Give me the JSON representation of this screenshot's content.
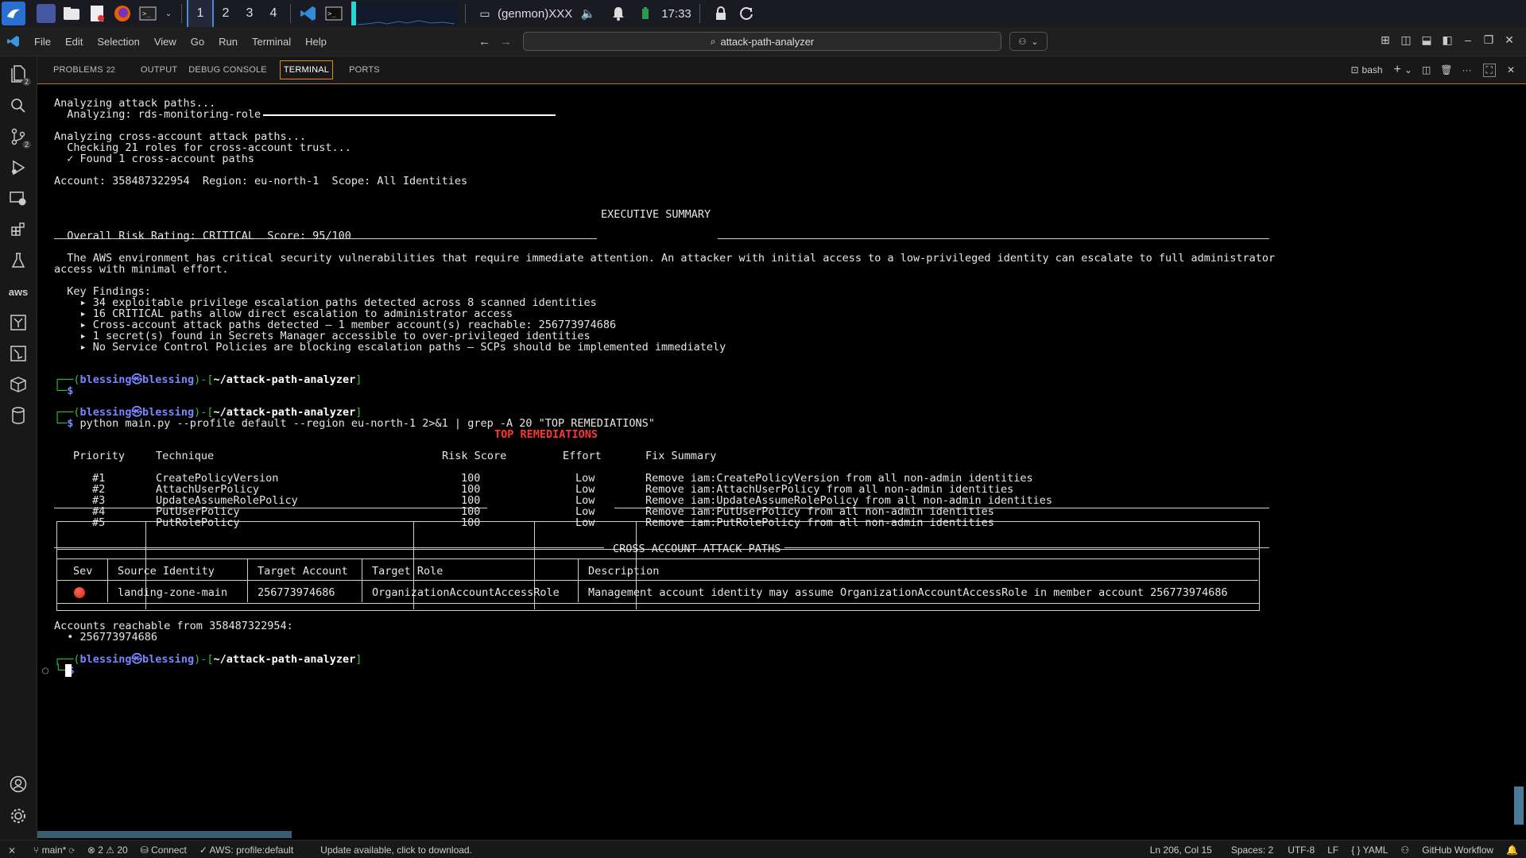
{
  "taskbar": {
    "workspaces": [
      "1",
      "2",
      "3",
      "4"
    ],
    "window_title": "(genmon)XXX",
    "clock": "17:33"
  },
  "titlebar": {
    "menu": [
      "File",
      "Edit",
      "Selection",
      "View",
      "Go",
      "Run",
      "Terminal",
      "Help"
    ],
    "search": "attack-path-analyzer"
  },
  "activity": {
    "explorer_badge": "2",
    "scm_badge": "2",
    "aws_label": "aws"
  },
  "panel": {
    "tabs": {
      "problems": "PROBLEMS",
      "problems_count": "22",
      "output": "OUTPUT",
      "debug": "DEBUG CONSOLE",
      "terminal": "TERMINAL",
      "ports": "PORTS"
    },
    "shell": "bash"
  },
  "terminal": {
    "l1": "Analyzing attack paths...",
    "l2": "  Analyzing: rds-monitoring-role",
    "l3": "Analyzing cross-account attack paths...",
    "l4": "  Checking 21 roles for cross-account trust...",
    "l5": "  ✓ Found 1 cross-account paths",
    "l6": "Account: 358487322954  Region: eu-north-1  Scope: All Identities",
    "exec_title": "EXECUTIVE SUMMARY",
    "risk": "  Overall Risk Rating: CRITICAL  Score: 95/100",
    "summary1": "  The AWS environment has critical security vulnerabilities that require immediate attention. An attacker with initial access to a low-privileged identity can escalate to full administrator",
    "summary2": "access with minimal effort.",
    "key_findings": "  Key Findings:",
    "findings": [
      "    ▸ 34 exploitable privilege escalation paths detected across 8 scanned identities",
      "    ▸ 16 CRITICAL paths allow direct escalation to administrator access",
      "    ▸ Cross-account attack paths detected — 1 member account(s) reachable: 256773974686",
      "    ▸ 1 secret(s) found in Secrets Manager accessible to over-privileged identities",
      "    ▸ No Service Control Policies are blocking escalation paths — SCPs should be implemented immediately"
    ],
    "prompt_user": "blessing",
    "prompt_at": "㉿",
    "prompt_host": "blessing",
    "prompt_dir": "~/attack-path-analyzer",
    "command": "python main.py --profile default --region eu-north-1 2>&1 | grep -A 20 \"TOP REMEDIATIONS\"",
    "remed_title": "TOP REMEDIATIONS",
    "remed_headers": [
      "Priority",
      "Technique",
      "Risk Score",
      "Effort",
      "Fix Summary"
    ],
    "remed_rows": [
      [
        "#1",
        "CreatePolicyVersion",
        "100",
        "Low",
        "Remove iam:CreatePolicyVersion from all non-admin identities"
      ],
      [
        "#2",
        "AttachUserPolicy",
        "100",
        "Low",
        "Remove iam:AttachUserPolicy from all non-admin identities"
      ],
      [
        "#3",
        "UpdateAssumeRolePolicy",
        "100",
        "Low",
        "Remove iam:UpdateAssumeRolePolicy from all non-admin identities"
      ],
      [
        "#4",
        "PutUserPolicy",
        "100",
        "Low",
        "Remove iam:PutUserPolicy from all non-admin identities"
      ],
      [
        "#5",
        "PutRolePolicy",
        "100",
        "Low",
        "Remove iam:PutRolePolicy from all non-admin identities"
      ]
    ],
    "cross_title": "CROSS-ACCOUNT ATTACK PATHS",
    "cross_headers": [
      "Sev",
      "Source Identity",
      "Target Account",
      "Target Role",
      "Description"
    ],
    "cross_row": [
      "landing-zone-main",
      "256773974686",
      "OrganizationAccountAccessRole",
      "Management account identity may assume OrganizationAccountAccessRole in member account 256773974686"
    ],
    "reachable": "Accounts reachable from 358487322954:",
    "reachable_item": "  • 256773974686"
  },
  "statusbar": {
    "branch": "main*",
    "errors": "2",
    "warnings": "20",
    "connect": "Connect",
    "aws": "AWS: profile:default",
    "update": "Update available, click to download.",
    "position": "Ln 206, Col 15",
    "spaces": "Spaces: 2",
    "encoding": "UTF-8",
    "eol": "LF",
    "language": "YAML",
    "workflow": "GitHub Workflow"
  },
  "colors": {
    "accent": "#d98c1f",
    "prompt_green": "#35c135",
    "prompt_blue": "#7a86ff",
    "critical_red": "#ff3333"
  }
}
